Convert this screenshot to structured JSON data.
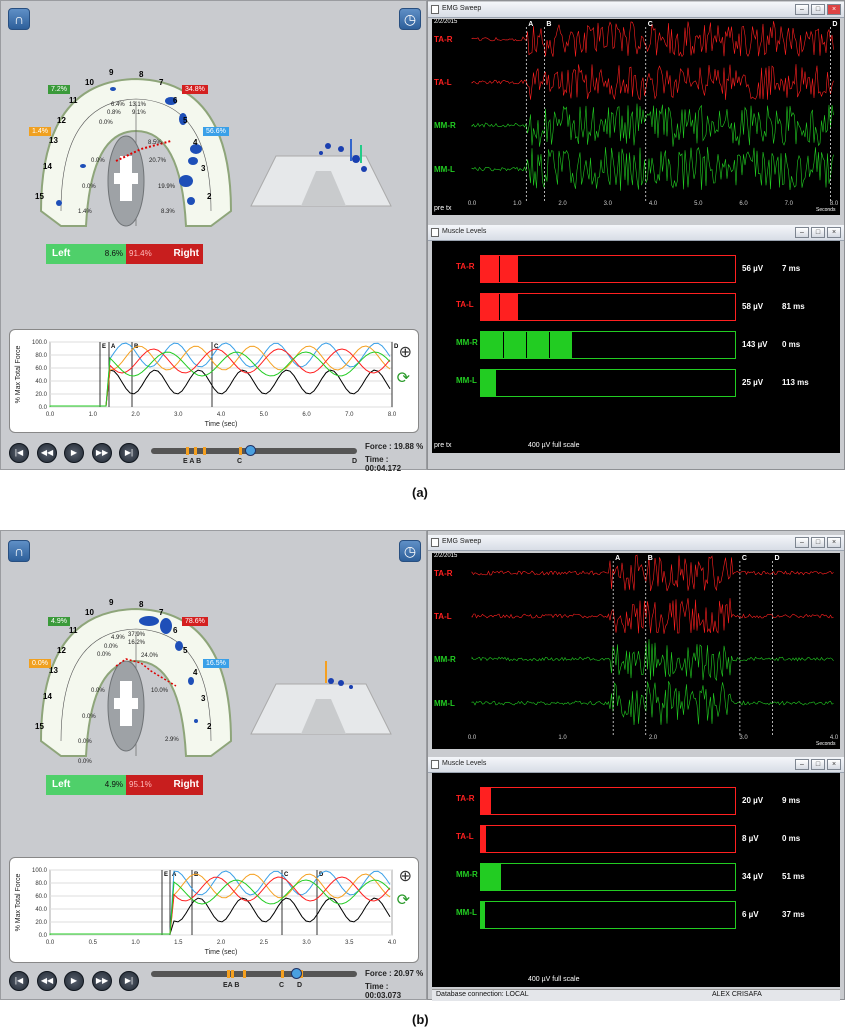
{
  "figure_a": {
    "caption": "(a)",
    "arch": {
      "tooth_numbers": [
        "9",
        "8",
        "10",
        "7",
        "11",
        "6",
        "12",
        "5",
        "13",
        "4",
        "14",
        "3",
        "15",
        "2"
      ],
      "badges": {
        "top_left": "7.2%",
        "top_right": "34.8%",
        "mid_left": "1.4%",
        "mid_right": "56.6%"
      },
      "inner_values": [
        "6.4%",
        "13.1%",
        "0.8%",
        "9.1%",
        "0.0%",
        "20.7%",
        "0.0%",
        "19.9%",
        "0.0%",
        "8.3%",
        "1.4%",
        "8.5%"
      ],
      "left_label": "Left",
      "left_value": "8.6%",
      "right_label": "Right",
      "right_value": "91.4%"
    },
    "force_plot": {
      "ylabel": "% Max Total Force",
      "xlabel": "Time (sec)",
      "yticks": [
        "100.0",
        "80.0",
        "60.0",
        "40.0",
        "20.0",
        "0.0"
      ],
      "xticks": [
        "0.0",
        "1.0",
        "2.0",
        "3.0",
        "4.0",
        "5.0",
        "6.0",
        "7.0",
        "8.0"
      ],
      "markers": [
        "E",
        "A",
        "B",
        "C",
        "D"
      ]
    },
    "playback": {
      "force_label": "Force : 19.88 %",
      "time_label": "Time : 00:04.172",
      "timeline_markers_1": "E A B",
      "timeline_marker_c": "C",
      "timeline_marker_d": "D"
    },
    "emg_sweep": {
      "title": "EMG Sweep",
      "date": "2/2/2015",
      "channels": [
        "TA-R",
        "TA-L",
        "MM-R",
        "MM-L"
      ],
      "markers": [
        "A",
        "B",
        "C",
        "D"
      ],
      "xticks": [
        "0.0",
        "1.0",
        "2.0",
        "3.0",
        "4.0",
        "5.0",
        "6.0",
        "7.0",
        "8.0"
      ],
      "xlabel": "Seconds",
      "bottom_label": "pre tx"
    },
    "muscle_levels": {
      "title": "Muscle Levels",
      "rows": [
        {
          "name": "TA-R",
          "uv": "56 µV",
          "ms": "7 ms",
          "level": 0.15,
          "color": "#ff2020",
          "segments": 2
        },
        {
          "name": "TA-L",
          "uv": "58 µV",
          "ms": "81 ms",
          "level": 0.15,
          "color": "#ff2020",
          "segments": 2
        },
        {
          "name": "MM-R",
          "uv": "143 µV",
          "ms": "0 ms",
          "level": 0.36,
          "color": "#22cc22",
          "segments": 4
        },
        {
          "name": "MM-L",
          "uv": "25 µV",
          "ms": "113 ms",
          "level": 0.06,
          "color": "#22cc22",
          "segments": 1
        }
      ],
      "footer_left": "pre tx",
      "footer_scale": "400 µV full scale"
    }
  },
  "figure_b": {
    "caption": "(b)",
    "arch": {
      "tooth_numbers": [
        "9",
        "8",
        "10",
        "7",
        "11",
        "6",
        "12",
        "5",
        "13",
        "4",
        "14",
        "3",
        "15",
        "2"
      ],
      "badges": {
        "top_left": "4.9%",
        "top_right": "78.6%",
        "mid_left": "0.0%",
        "mid_right": "16.5%"
      },
      "inner_values": [
        "4.9%",
        "37.9%",
        "0.0%",
        "16.2%",
        "0.0%",
        "24.0%",
        "0.0%",
        "10.0%",
        "0.0%",
        "2.9%",
        "0.0%",
        "0.0%"
      ],
      "left_label": "Left",
      "left_value": "4.9%",
      "right_label": "Right",
      "right_value": "95.1%"
    },
    "force_plot": {
      "ylabel": "% Max Total Force",
      "xlabel": "Time (sec)",
      "yticks": [
        "100.0",
        "80.0",
        "60.0",
        "40.0",
        "20.0",
        "0.0"
      ],
      "xticks": [
        "0.0",
        "0.5",
        "1.0",
        "1.5",
        "2.0",
        "2.5",
        "3.0",
        "3.5",
        "4.0"
      ],
      "markers": [
        "E",
        "A",
        "B",
        "C",
        "D"
      ]
    },
    "playback": {
      "force_label": "Force : 20.97 %",
      "time_label": "Time : 00:03.073",
      "timeline_markers_1": "EA B",
      "timeline_marker_c": "C",
      "timeline_marker_d": "D"
    },
    "emg_sweep": {
      "title": "EMG Sweep",
      "date": "2/2/2015",
      "channels": [
        "TA-R",
        "TA-L",
        "MM-R",
        "MM-L"
      ],
      "markers": [
        "A",
        "B",
        "C",
        "D"
      ],
      "xticks": [
        "0.0",
        "1.0",
        "2.0",
        "3.0",
        "4.0"
      ],
      "xlabel": "Seconds"
    },
    "muscle_levels": {
      "title": "Muscle Levels",
      "rows": [
        {
          "name": "TA-R",
          "uv": "20 µV",
          "ms": "9 ms",
          "level": 0.04,
          "color": "#ff2020",
          "segments": 1
        },
        {
          "name": "TA-L",
          "uv": "8 µV",
          "ms": "0 ms",
          "level": 0.02,
          "color": "#ff2020",
          "segments": 1
        },
        {
          "name": "MM-R",
          "uv": "34 µV",
          "ms": "51 ms",
          "level": 0.08,
          "color": "#22cc22",
          "segments": 1
        },
        {
          "name": "MM-L",
          "uv": "6 µV",
          "ms": "37 ms",
          "level": 0.01,
          "color": "#22cc22",
          "segments": 1
        }
      ],
      "footer_scale": "400 µV full scale",
      "status_left": "Database connection: LOCAL",
      "status_right": "ALEX CRISAFA"
    }
  },
  "colors": {
    "red": "#ff2020",
    "green": "#22cc22",
    "orange": "#f5a020",
    "blue": "#3aa0e8",
    "left_green": "#4fd06a",
    "right_red": "#c81e1e"
  },
  "icons": {
    "arch_button": "arch-icon",
    "clock_button": "clock-icon",
    "zoom": "zoom-in-icon",
    "refresh": "refresh-icon",
    "window": "window-icon"
  }
}
